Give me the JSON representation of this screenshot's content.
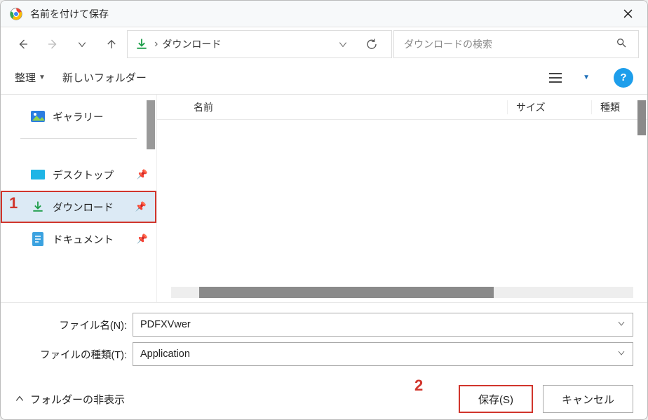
{
  "title": "名前を付けて保存",
  "breadcrumb": "ダウンロード",
  "search_placeholder": "ダウンロードの検索",
  "toolbar": {
    "organize": "整理",
    "new_folder": "新しいフォルダー"
  },
  "sidebar": {
    "gallery": "ギャラリー",
    "items": [
      {
        "label": "デスクトップ"
      },
      {
        "label": "ダウンロード"
      },
      {
        "label": "ドキュメント"
      }
    ]
  },
  "columns": {
    "name": "名前",
    "size": "サイズ",
    "type": "種類"
  },
  "form": {
    "filename_label": "ファイル名(N):",
    "filename_value": "PDFXVwer",
    "filetype_label": "ファイルの種類(T):",
    "filetype_value": "Application"
  },
  "footer": {
    "hide_folders": "フォルダーの非表示",
    "save": "保存(S)",
    "cancel": "キャンセル"
  },
  "annotations": {
    "a1": "1",
    "a2": "2"
  }
}
